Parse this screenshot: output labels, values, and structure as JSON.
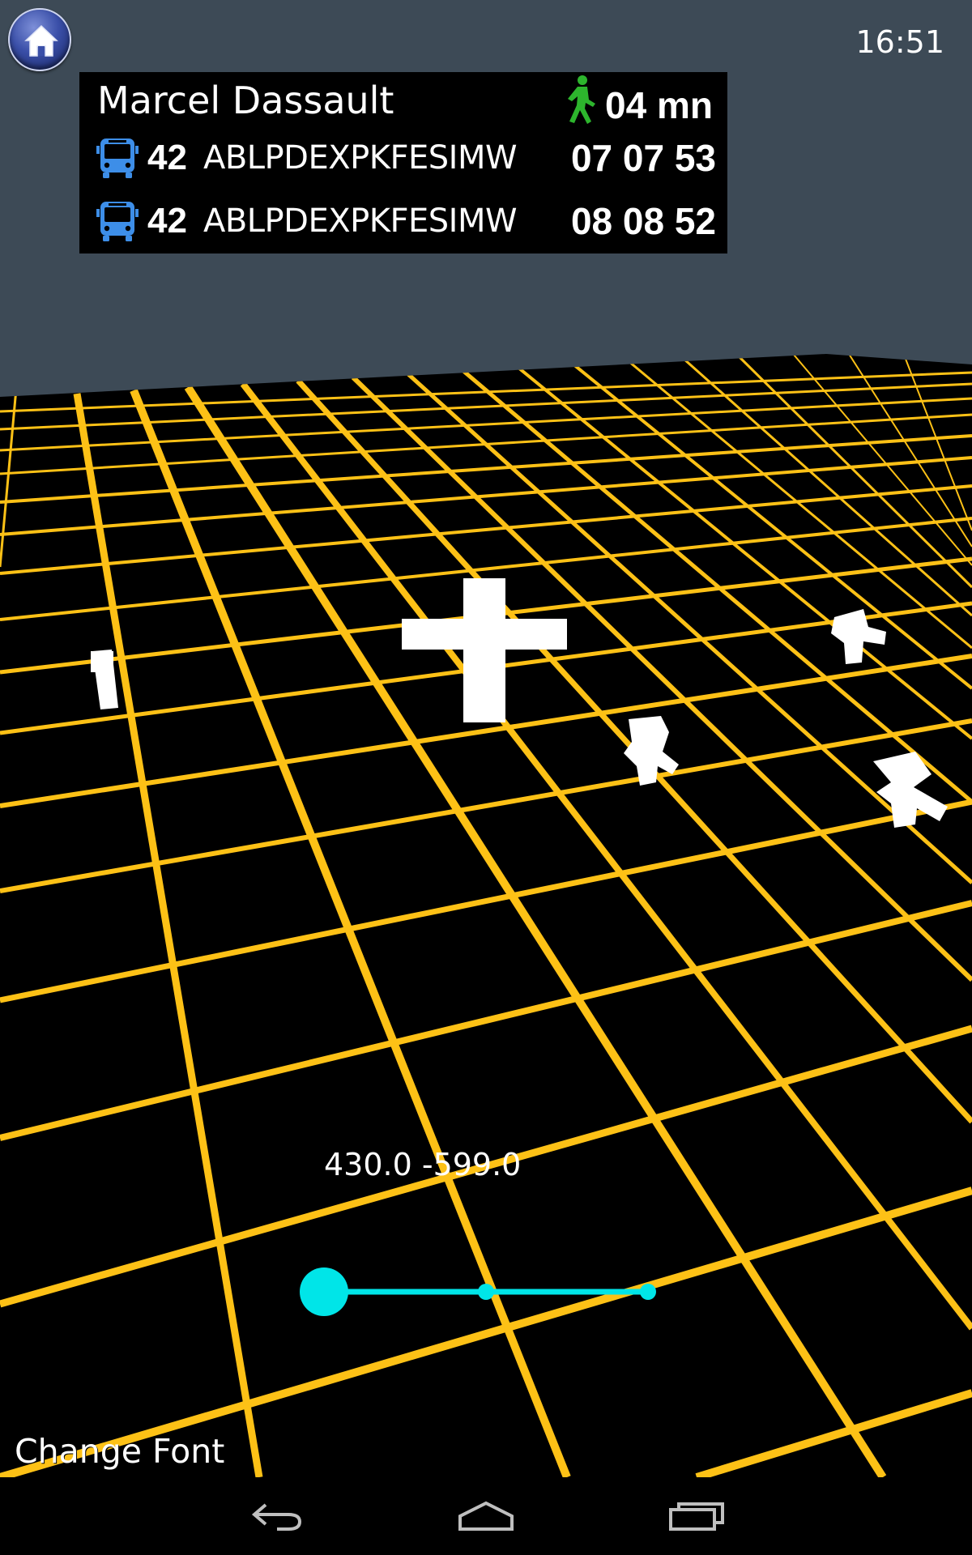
{
  "status_bar": {
    "time": "16:51"
  },
  "home_button": {
    "icon": "home-icon"
  },
  "stop": {
    "name": "Marcel Dassault",
    "walk_icon": "pedestrian-icon",
    "walk_time": "04 mn",
    "departures": [
      {
        "icon": "bus-icon",
        "route": "42",
        "destination": "ABLPDEXPKFESIMW",
        "time": "07 07 53"
      },
      {
        "icon": "bus-icon",
        "route": "42",
        "destination": "ABLPDEXPKFESIMW",
        "time": "08 08 52"
      }
    ]
  },
  "scene": {
    "coordinates": "430.0 -599.0",
    "slider_position": 0
  },
  "change_font_label": "Change Font",
  "navigation": {
    "back_icon": "back-icon",
    "home_icon": "home-outline-icon",
    "recents_icon": "recent-apps-icon"
  },
  "colors": {
    "sky": "#3d4a56",
    "ground": "#000000",
    "grid_line": "#fdc116",
    "slider": "#00e5e8",
    "walk_green": "#2db52d",
    "bus_blue": "#3d8ee8"
  }
}
